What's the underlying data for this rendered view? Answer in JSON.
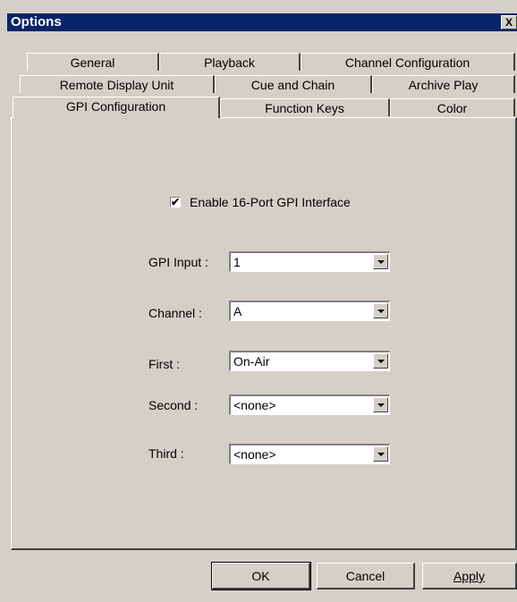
{
  "window": {
    "title": "Options",
    "close_glyph": "X"
  },
  "tabs": {
    "row1": [
      "General",
      "Playback",
      "Channel Configuration"
    ],
    "row2": [
      "Remote Display Unit",
      "Cue and Chain",
      "Archive Play"
    ],
    "row3": [
      "GPI Configuration",
      "Function Keys",
      "Color"
    ],
    "active": "GPI Configuration"
  },
  "gpi": {
    "enable_label": "Enable 16-Port GPI Interface",
    "enable_checked": true,
    "fields": [
      {
        "label": "GPI Input :",
        "value": "1"
      },
      {
        "label": "Channel :",
        "value": "A"
      },
      {
        "label": "First :",
        "value": "On-Air"
      },
      {
        "label": "Second :",
        "value": "<none>"
      },
      {
        "label": "Third :",
        "value": "<none>"
      }
    ]
  },
  "buttons": {
    "ok": "OK",
    "cancel": "Cancel",
    "apply": "Apply"
  }
}
